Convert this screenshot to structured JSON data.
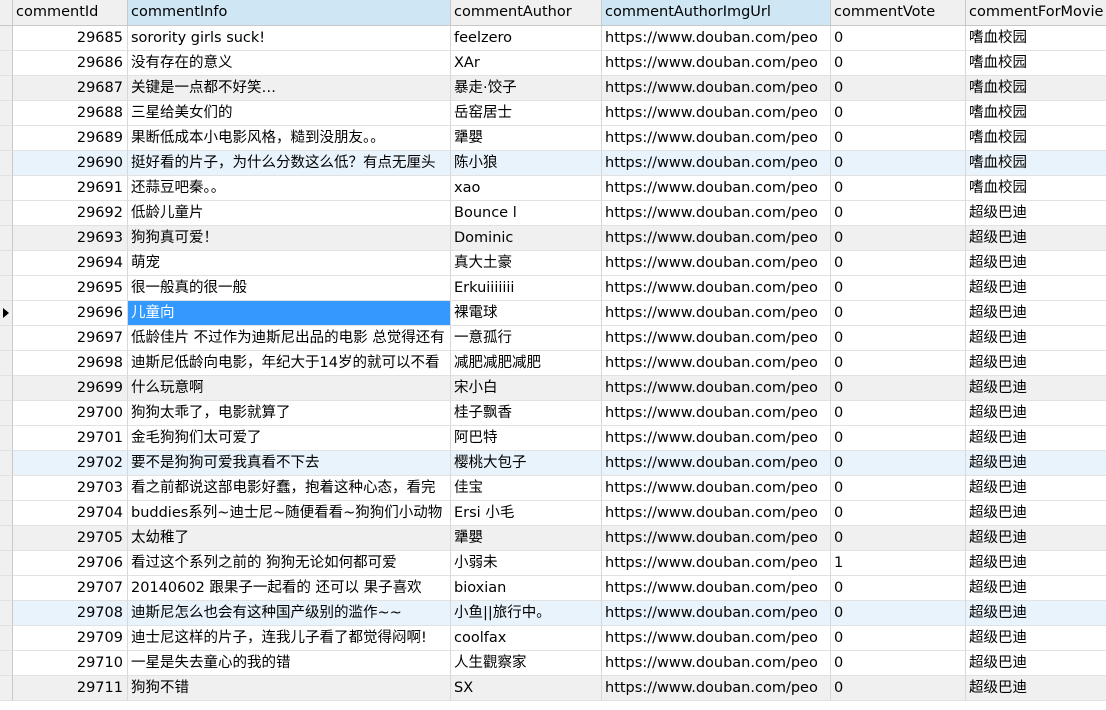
{
  "columns": [
    "commentId",
    "commentInfo",
    "commentAuthor",
    "commentAuthorImgUrl",
    "commentVote",
    "commentForMovie"
  ],
  "selected_column": 1,
  "current_row": 11,
  "rows": [
    {
      "id": "29685",
      "info": "sorority girls suck!",
      "author": "feelzero",
      "url": "https://www.douban.com/peo",
      "vote": "0",
      "movie": "嗜血校园"
    },
    {
      "id": "29686",
      "info": "没有存在的意义",
      "author": "XAr",
      "url": "https://www.douban.com/peo",
      "vote": "0",
      "movie": "嗜血校园"
    },
    {
      "id": "29687",
      "info": "关键是一点都不好笑…",
      "author": "暴走·饺子",
      "url": "https://www.douban.com/peo",
      "vote": "0",
      "movie": "嗜血校园"
    },
    {
      "id": "29688",
      "info": "三星给美女们的",
      "author": "岳窑居士",
      "url": "https://www.douban.com/peo",
      "vote": "0",
      "movie": "嗜血校园"
    },
    {
      "id": "29689",
      "info": "果断低成本小电影风格，糙到没朋友。。",
      "author": "犟嬰",
      "url": "https://www.douban.com/peo",
      "vote": "0",
      "movie": "嗜血校园"
    },
    {
      "id": "29690",
      "info": "挺好看的片子，为什么分数这么低？有点无厘头",
      "author": "陈小狼",
      "url": "https://www.douban.com/peo",
      "vote": "0",
      "movie": "嗜血校园"
    },
    {
      "id": "29691",
      "info": "还蒜豆吧秦。。",
      "author": "xao",
      "url": "https://www.douban.com/peo",
      "vote": "0",
      "movie": "嗜血校园"
    },
    {
      "id": "29692",
      "info": "低龄儿童片",
      "author": "Bounce l",
      "url": "https://www.douban.com/peo",
      "vote": "0",
      "movie": "超级巴迪"
    },
    {
      "id": "29693",
      "info": "狗狗真可爱！",
      "author": "Dominic",
      "url": "https://www.douban.com/peo",
      "vote": "0",
      "movie": "超级巴迪"
    },
    {
      "id": "29694",
      "info": "萌宠",
      "author": "真大土豪",
      "url": "https://www.douban.com/peo",
      "vote": "0",
      "movie": "超级巴迪"
    },
    {
      "id": "29695",
      "info": "很一般真的很一般",
      "author": "Erkuiiiiiii",
      "url": "https://www.douban.com/peo",
      "vote": "0",
      "movie": "超级巴迪"
    },
    {
      "id": "29696",
      "info": "儿童向",
      "author": "裸電球",
      "url": "https://www.douban.com/peo",
      "vote": "0",
      "movie": "超级巴迪"
    },
    {
      "id": "29697",
      "info": "低龄佳片 不过作为迪斯尼出品的电影 总觉得还有",
      "author": "一意孤行",
      "url": "https://www.douban.com/peo",
      "vote": "0",
      "movie": "超级巴迪"
    },
    {
      "id": "29698",
      "info": "迪斯尼低龄向电影，年纪大于14岁的就可以不看",
      "author": "减肥减肥减肥",
      "url": "https://www.douban.com/peo",
      "vote": "0",
      "movie": "超级巴迪"
    },
    {
      "id": "29699",
      "info": "什么玩意啊",
      "author": "宋小白",
      "url": "https://www.douban.com/peo",
      "vote": "0",
      "movie": "超级巴迪"
    },
    {
      "id": "29700",
      "info": "狗狗太乖了，电影就算了",
      "author": "桂子飘香",
      "url": "https://www.douban.com/peo",
      "vote": "0",
      "movie": "超级巴迪"
    },
    {
      "id": "29701",
      "info": "金毛狗狗们太可爱了",
      "author": "阿巴特",
      "url": "https://www.douban.com/peo",
      "vote": "0",
      "movie": "超级巴迪"
    },
    {
      "id": "29702",
      "info": "要不是狗狗可爱我真看不下去",
      "author": "樱桃大包子",
      "url": "https://www.douban.com/peo",
      "vote": "0",
      "movie": "超级巴迪"
    },
    {
      "id": "29703",
      "info": "看之前都说这部电影好蠢，抱着这种心态，看完",
      "author": "佳宝",
      "url": "https://www.douban.com/peo",
      "vote": "0",
      "movie": "超级巴迪"
    },
    {
      "id": "29704",
      "info": "buddies系列~迪士尼~随便看看~狗狗们小动物",
      "author": "Ersi 小毛",
      "url": "https://www.douban.com/peo",
      "vote": "0",
      "movie": "超级巴迪"
    },
    {
      "id": "29705",
      "info": "太幼稚了",
      "author": "犟嬰",
      "url": "https://www.douban.com/peo",
      "vote": "0",
      "movie": "超级巴迪"
    },
    {
      "id": "29706",
      "info": "看过这个系列之前的 狗狗无论如何都可爱",
      "author": "小弱未",
      "url": "https://www.douban.com/peo",
      "vote": "1",
      "movie": "超级巴迪"
    },
    {
      "id": "29707",
      "info": "20140602 跟果子一起看的 还可以 果子喜欢",
      "author": "bioxian",
      "url": "https://www.douban.com/peo",
      "vote": "0",
      "movie": "超级巴迪"
    },
    {
      "id": "29708",
      "info": "迪斯尼怎么也会有这种国产级别的滥作~~",
      "author": "小鱼||旅行中。",
      "url": "https://www.douban.com/peo",
      "vote": "0",
      "movie": "超级巴迪"
    },
    {
      "id": "29709",
      "info": "迪士尼这样的片子，连我儿子看了都觉得闷啊!",
      "author": "coolfax",
      "url": "https://www.douban.com/peo",
      "vote": "0",
      "movie": "超级巴迪"
    },
    {
      "id": "29710",
      "info": "一星是失去童心的我的错",
      "author": "人生觀察家",
      "url": "https://www.douban.com/peo",
      "vote": "0",
      "movie": "超级巴迪"
    },
    {
      "id": "29711",
      "info": "狗狗不错",
      "author": "SX",
      "url": "https://www.douban.com/peo",
      "vote": "0",
      "movie": "超级巴迪"
    }
  ]
}
